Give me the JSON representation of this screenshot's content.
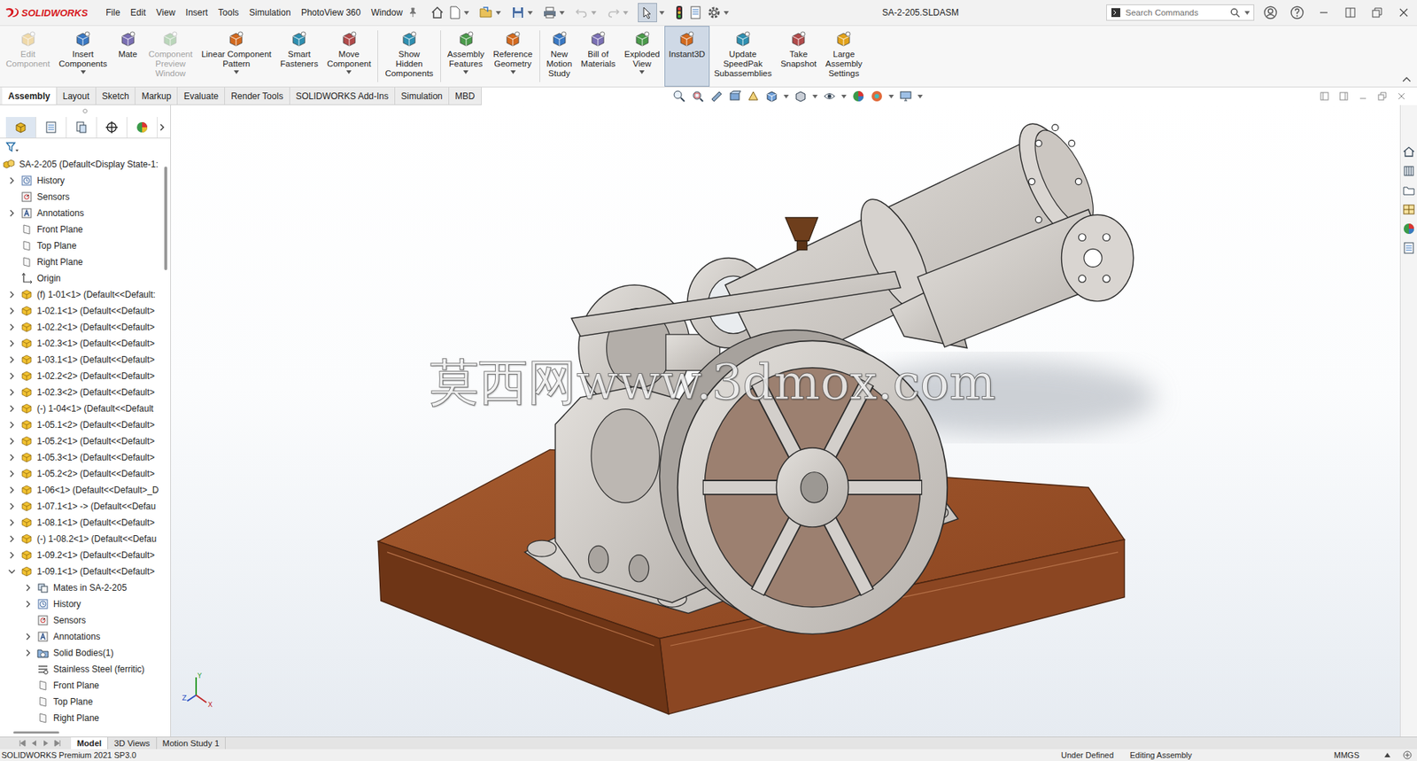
{
  "window": {
    "title": "SA-2-205.SLDASM"
  },
  "app": {
    "logo": "SOLIDWORKS"
  },
  "menu": [
    "File",
    "Edit",
    "View",
    "Insert",
    "Tools",
    "Simulation",
    "PhotoView 360",
    "Window"
  ],
  "search": {
    "placeholder": "Search Commands"
  },
  "ribbon": {
    "groups": [
      [
        {
          "label": "Edit\nComponent",
          "disabled": true,
          "selected": false,
          "dropdown": false
        },
        {
          "label": "Insert\nComponents",
          "disabled": false,
          "selected": false,
          "dropdown": true
        },
        {
          "label": "Mate",
          "disabled": false,
          "selected": false,
          "dropdown": false
        },
        {
          "label": "Component\nPreview\nWindow",
          "disabled": true,
          "selected": false,
          "dropdown": false
        },
        {
          "label": "Linear Component\nPattern",
          "disabled": false,
          "selected": false,
          "dropdown": true
        },
        {
          "label": "Smart\nFasteners",
          "disabled": false,
          "selected": false,
          "dropdown": false
        },
        {
          "label": "Move\nComponent",
          "disabled": false,
          "selected": false,
          "dropdown": true
        }
      ],
      [
        {
          "label": "Show\nHidden\nComponents",
          "disabled": false,
          "selected": false,
          "dropdown": false
        }
      ],
      [
        {
          "label": "Assembly\nFeatures",
          "disabled": false,
          "selected": false,
          "dropdown": true
        },
        {
          "label": "Reference\nGeometry",
          "disabled": false,
          "selected": false,
          "dropdown": true
        }
      ],
      [
        {
          "label": "New\nMotion\nStudy",
          "disabled": false,
          "selected": false,
          "dropdown": false
        },
        {
          "label": "Bill of\nMaterials",
          "disabled": false,
          "selected": false,
          "dropdown": false
        },
        {
          "label": "Exploded\nView",
          "disabled": false,
          "selected": false,
          "dropdown": true
        },
        {
          "label": "Instant3D",
          "disabled": false,
          "selected": true,
          "dropdown": false
        },
        {
          "label": "Update\nSpeedPak\nSubassemblies",
          "disabled": false,
          "selected": false,
          "dropdown": false
        },
        {
          "label": "Take\nSnapshot",
          "disabled": false,
          "selected": false,
          "dropdown": false
        },
        {
          "label": "Large\nAssembly\nSettings",
          "disabled": false,
          "selected": false,
          "dropdown": false
        }
      ]
    ]
  },
  "tabs": [
    {
      "label": "Assembly",
      "selected": true
    },
    {
      "label": "Layout",
      "selected": false
    },
    {
      "label": "Sketch",
      "selected": false
    },
    {
      "label": "Markup",
      "selected": false
    },
    {
      "label": "Evaluate",
      "selected": false
    },
    {
      "label": "Render Tools",
      "selected": false
    },
    {
      "label": "SOLIDWORKS Add-Ins",
      "selected": false
    },
    {
      "label": "Simulation",
      "selected": false
    },
    {
      "label": "MBD",
      "selected": false
    }
  ],
  "panel_tabs": [
    {
      "selected": true
    },
    {
      "selected": false
    },
    {
      "selected": false
    },
    {
      "selected": false
    },
    {
      "selected": false
    }
  ],
  "feature_tree": {
    "items": [
      {
        "text": "SA-2-205 (Default<Display State-1:",
        "level": 0,
        "kind": "assembly",
        "expandable": false,
        "expanded": false
      },
      {
        "text": "History",
        "level": 0,
        "kind": "history",
        "expandable": true,
        "expanded": false
      },
      {
        "text": "Sensors",
        "level": 0,
        "kind": "sensors",
        "expandable": false,
        "expanded": false
      },
      {
        "text": "Annotations",
        "level": 0,
        "kind": "annotations",
        "expandable": true,
        "expanded": false
      },
      {
        "text": "Front Plane",
        "level": 0,
        "kind": "plane",
        "expandable": false,
        "expanded": false
      },
      {
        "text": "Top Plane",
        "level": 0,
        "kind": "plane",
        "expandable": false,
        "expanded": false
      },
      {
        "text": "Right Plane",
        "level": 0,
        "kind": "plane",
        "expandable": false,
        "expanded": false
      },
      {
        "text": "Origin",
        "level": 0,
        "kind": "origin",
        "expandable": false,
        "expanded": false
      },
      {
        "text": "(f) 1-01<1> (Default<<Default:",
        "level": 0,
        "kind": "part",
        "expandable": true,
        "expanded": false
      },
      {
        "text": "1-02.1<1> (Default<<Default>",
        "level": 0,
        "kind": "part",
        "expandable": true,
        "expanded": false
      },
      {
        "text": "1-02.2<1> (Default<<Default>",
        "level": 0,
        "kind": "part",
        "expandable": true,
        "expanded": false
      },
      {
        "text": "1-02.3<1> (Default<<Default>",
        "level": 0,
        "kind": "part",
        "expandable": true,
        "expanded": false
      },
      {
        "text": "1-03.1<1> (Default<<Default>",
        "level": 0,
        "kind": "part",
        "expandable": true,
        "expanded": false
      },
      {
        "text": "1-02.2<2> (Default<<Default>",
        "level": 0,
        "kind": "part",
        "expandable": true,
        "expanded": false
      },
      {
        "text": "1-02.3<2> (Default<<Default>",
        "level": 0,
        "kind": "part",
        "expandable": true,
        "expanded": false
      },
      {
        "text": "(-) 1-04<1> (Default<<Default",
        "level": 0,
        "kind": "part",
        "expandable": true,
        "expanded": false
      },
      {
        "text": "1-05.1<2> (Default<<Default>",
        "level": 0,
        "kind": "part",
        "expandable": true,
        "expanded": false
      },
      {
        "text": "1-05.2<1> (Default<<Default>",
        "level": 0,
        "kind": "part",
        "expandable": true,
        "expanded": false
      },
      {
        "text": "1-05.3<1> (Default<<Default>",
        "level": 0,
        "kind": "part",
        "expandable": true,
        "expanded": false
      },
      {
        "text": "1-05.2<2> (Default<<Default>",
        "level": 0,
        "kind": "part",
        "expandable": true,
        "expanded": false
      },
      {
        "text": "1-06<1> (Default<<Default>_D",
        "level": 0,
        "kind": "part",
        "expandable": true,
        "expanded": false
      },
      {
        "text": "1-07.1<1> -> (Default<<Defau",
        "level": 0,
        "kind": "part",
        "expandable": true,
        "expanded": false
      },
      {
        "text": "1-08.1<1> (Default<<Default>",
        "level": 0,
        "kind": "part",
        "expandable": true,
        "expanded": false
      },
      {
        "text": "(-) 1-08.2<1> (Default<<Defau",
        "level": 0,
        "kind": "part",
        "expandable": true,
        "expanded": false
      },
      {
        "text": "1-09.2<1> (Default<<Default>",
        "level": 0,
        "kind": "part",
        "expandable": true,
        "expanded": false
      },
      {
        "text": "1-09.1<1> (Default<<Default>",
        "level": 0,
        "kind": "part",
        "expandable": true,
        "expanded": true
      },
      {
        "text": "Mates in SA-2-205",
        "level": 1,
        "kind": "mates",
        "expandable": true,
        "expanded": false
      },
      {
        "text": "History",
        "level": 1,
        "kind": "history",
        "expandable": true,
        "expanded": false
      },
      {
        "text": "Sensors",
        "level": 1,
        "kind": "sensors",
        "expandable": false,
        "expanded": false
      },
      {
        "text": "Annotations",
        "level": 1,
        "kind": "annotations",
        "expandable": true,
        "expanded": false
      },
      {
        "text": "Solid Bodies(1)",
        "level": 1,
        "kind": "solids",
        "expandable": true,
        "expanded": false
      },
      {
        "text": "Stainless Steel (ferritic)",
        "level": 1,
        "kind": "material",
        "expandable": false,
        "expanded": false
      },
      {
        "text": "Front Plane",
        "level": 1,
        "kind": "plane",
        "expandable": false,
        "expanded": false
      },
      {
        "text": "Top Plane",
        "level": 1,
        "kind": "plane",
        "expandable": false,
        "expanded": false
      },
      {
        "text": "Right Plane",
        "level": 1,
        "kind": "plane",
        "expandable": false,
        "expanded": false
      }
    ]
  },
  "viewport": {
    "watermark": "莫西网www.3dmox.com",
    "triad": [
      "Y",
      "Z",
      "X"
    ]
  },
  "bottom_tabs": [
    {
      "label": "Model",
      "selected": true
    },
    {
      "label": "3D Views",
      "selected": false
    },
    {
      "label": "Motion Study 1",
      "selected": false
    }
  ],
  "status_bar": {
    "product": "SOLIDWORKS Premium 2021 SP3.0",
    "state": "Under Defined",
    "mode": "Editing Assembly",
    "units": "MMGS"
  }
}
